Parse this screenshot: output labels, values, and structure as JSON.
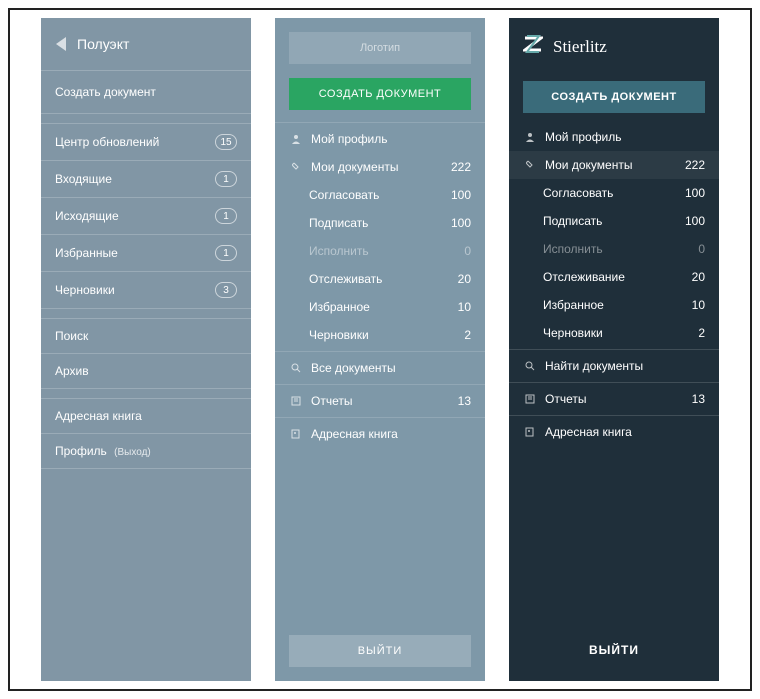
{
  "sidebarA": {
    "brand": "Полуэкт",
    "create": "Создать документ",
    "items": [
      {
        "label": "Центр обновлений",
        "count": "15"
      },
      {
        "label": "Входящие",
        "count": "1"
      },
      {
        "label": "Исходящие",
        "count": "1"
      },
      {
        "label": "Избранные",
        "count": "1"
      },
      {
        "label": "Черновики",
        "count": "3"
      }
    ],
    "search": "Поиск",
    "archive": "Архив",
    "addressBook": "Адресная книга",
    "profile": "Профиль",
    "logout": "(Выход)"
  },
  "sidebarB": {
    "logo": "Логотип",
    "create": "СОЗДАТЬ ДОКУМЕНТ",
    "profile": "Мой профиль",
    "myDocs": {
      "label": "Мои документы",
      "count": "222"
    },
    "subs": [
      {
        "label": "Согласовать",
        "count": "100"
      },
      {
        "label": "Подписать",
        "count": "100"
      },
      {
        "label": "Исполнить",
        "count": "0",
        "muted": true
      },
      {
        "label": "Отслеживать",
        "count": "20"
      },
      {
        "label": "Избранное",
        "count": "10"
      },
      {
        "label": "Черновики",
        "count": "2"
      }
    ],
    "allDocs": "Все документы",
    "reports": {
      "label": "Отчеты",
      "count": "13"
    },
    "addressBook": "Адресная книга",
    "logout": "ВЫЙТИ"
  },
  "sidebarC": {
    "brand": "Stierlitz",
    "create": "СОЗДАТЬ ДОКУМЕНТ",
    "profile": "Мой профиль",
    "myDocs": {
      "label": "Мои документы",
      "count": "222"
    },
    "subs": [
      {
        "label": "Согласовать",
        "count": "100"
      },
      {
        "label": "Подписать",
        "count": "100"
      },
      {
        "label": "Исполнить",
        "count": "0",
        "muted": true
      },
      {
        "label": "Отслеживание",
        "count": "20"
      },
      {
        "label": "Избранное",
        "count": "10"
      },
      {
        "label": "Черновики",
        "count": "2"
      }
    ],
    "findDocs": "Найти документы",
    "reports": {
      "label": "Отчеты",
      "count": "13"
    },
    "addressBook": "Адресная книга",
    "logout": "ВЫЙТИ"
  }
}
